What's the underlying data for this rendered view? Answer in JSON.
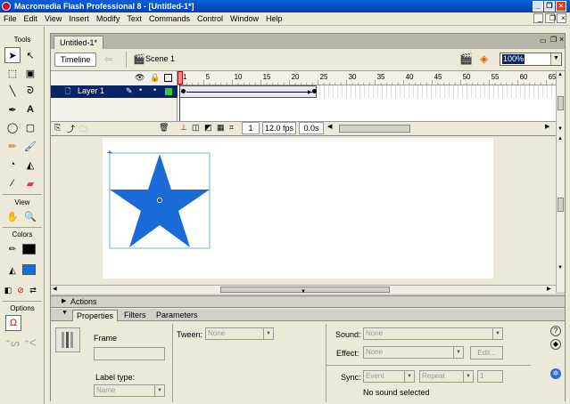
{
  "window": {
    "title": "Macromedia Flash Professional 8 - [Untitled-1*]"
  },
  "menu": [
    "File",
    "Edit",
    "View",
    "Insert",
    "Modify",
    "Text",
    "Commands",
    "Control",
    "Window",
    "Help"
  ],
  "tools": {
    "header": "Tools",
    "view_label": "View",
    "colors_label": "Colors",
    "options_label": "Options",
    "stroke_color": "#000000",
    "fill_color": "#1a6ad8"
  },
  "document": {
    "tab_title": "Untitled-1*",
    "timeline_button": "Timeline",
    "scene_label": "Scene 1",
    "zoom": "100%"
  },
  "timeline": {
    "layer_name": "Layer 1",
    "ruler_ticks": [
      "1",
      "5",
      "10",
      "15",
      "20",
      "25",
      "30",
      "35",
      "40",
      "45",
      "50",
      "55",
      "60",
      "65"
    ],
    "current_frame": "1",
    "fps": "12.0 fps",
    "elapsed": "0.0s"
  },
  "stage": {
    "shape": "star",
    "fill": "#1a6ad8",
    "selection_color": "#6ab0e8"
  },
  "panels": {
    "actions": "Actions"
  },
  "properties": {
    "tabs": [
      "Properties",
      "Filters",
      "Parameters"
    ],
    "frame_label": "Frame",
    "tween_label": "Tween:",
    "tween_value": "None",
    "label_type_label": "Label type:",
    "label_type_value": "Name",
    "sound_label": "Sound:",
    "sound_value": "None",
    "effect_label": "Effect:",
    "effect_value": "None",
    "edit_button": "Edit...",
    "sync_label": "Sync:",
    "sync_value": "Event",
    "repeat_value": "Repeat",
    "repeat_count": "1",
    "sound_status": "No sound selected"
  }
}
